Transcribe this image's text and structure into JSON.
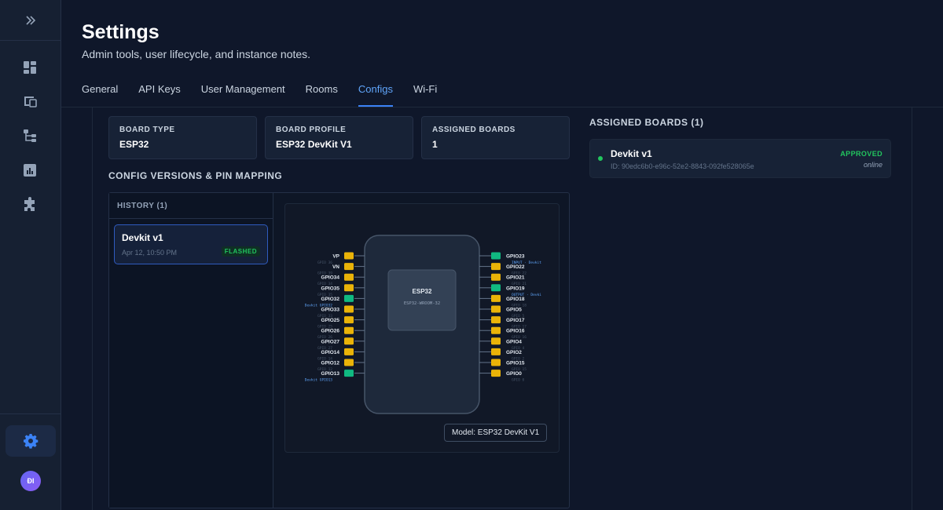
{
  "sidebar": {
    "toggle_icon": "chevrons-right-icon",
    "items": [
      {
        "icon": "dashboard-icon"
      },
      {
        "icon": "devices-icon"
      },
      {
        "icon": "hierarchy-icon"
      },
      {
        "icon": "reports-icon"
      },
      {
        "icon": "puzzle-icon"
      }
    ],
    "settings_icon": "gear-icon",
    "avatar_initials": "ĐI"
  },
  "header": {
    "title": "Settings",
    "subtitle": "Admin tools, user lifecycle, and instance notes.",
    "tabs": [
      {
        "label": "General",
        "active": false
      },
      {
        "label": "API Keys",
        "active": false
      },
      {
        "label": "User Management",
        "active": false
      },
      {
        "label": "Rooms",
        "active": false
      },
      {
        "label": "Configs",
        "active": true
      },
      {
        "label": "Wi-Fi",
        "active": false
      }
    ]
  },
  "summary_cards": [
    {
      "label": "BOARD TYPE",
      "value": "ESP32"
    },
    {
      "label": "BOARD PROFILE",
      "value": "ESP32 DevKit V1"
    },
    {
      "label": "ASSIGNED BOARDS",
      "value": "1"
    }
  ],
  "config_section": {
    "title": "CONFIG VERSIONS & PIN MAPPING",
    "history_label": "HISTORY (1)",
    "history_items": [
      {
        "name": "Devkit v1",
        "date": "Apr 12, 10:50 PM",
        "badge": "FLASHED"
      }
    ]
  },
  "board": {
    "chip_name": "ESP32",
    "chip_model": "ESP32-WROOM-32",
    "model_label": "Model: ESP32 DevKit V1",
    "left_pins": [
      {
        "name": "VP",
        "sub": "GPIO 36",
        "state": "unused"
      },
      {
        "name": "VN",
        "sub": "GPIO 39",
        "state": "unused"
      },
      {
        "name": "GPIO34",
        "sub": "GPIO 34",
        "state": "unused"
      },
      {
        "name": "GPIO35",
        "sub": "GPIO 35",
        "state": "unused"
      },
      {
        "name": "GPIO32",
        "sub": "Devkit GPIO32",
        "state": "used"
      },
      {
        "name": "GPIO33",
        "sub": "GPIO 33",
        "state": "unused"
      },
      {
        "name": "GPIO25",
        "sub": "GPIO 25",
        "state": "unused"
      },
      {
        "name": "GPIO26",
        "sub": "GPIO 26",
        "state": "unused"
      },
      {
        "name": "GPIO27",
        "sub": "GPIO 27",
        "state": "unused"
      },
      {
        "name": "GPIO14",
        "sub": "GPIO 14",
        "state": "unused"
      },
      {
        "name": "GPIO12",
        "sub": "GPIO 12",
        "state": "unused"
      },
      {
        "name": "GPIO13",
        "sub": "Devkit GPIO13",
        "state": "used"
      }
    ],
    "right_pins": [
      {
        "name": "GPIO23",
        "sub": "INPUT · Devkit",
        "state": "used"
      },
      {
        "name": "GPIO22",
        "sub": "GPIO 22",
        "state": "unused"
      },
      {
        "name": "GPIO21",
        "sub": "GPIO 21",
        "state": "unused"
      },
      {
        "name": "GPIO19",
        "sub": "OUTPUT · Devki",
        "state": "used"
      },
      {
        "name": "GPIO18",
        "sub": "GPIO 18",
        "state": "unused"
      },
      {
        "name": "GPIO5",
        "sub": "GPIO 5",
        "state": "unused"
      },
      {
        "name": "GPIO17",
        "sub": "GPIO 17",
        "state": "unused"
      },
      {
        "name": "GPIO16",
        "sub": "GPIO 16",
        "state": "unused"
      },
      {
        "name": "GPIO4",
        "sub": "GPIO 4",
        "state": "unused"
      },
      {
        "name": "GPIO2",
        "sub": "GPIO 2",
        "state": "unused"
      },
      {
        "name": "GPIO15",
        "sub": "GPIO 15",
        "state": "unused"
      },
      {
        "name": "GPIO0",
        "sub": "GPIO 0",
        "state": "unused"
      }
    ],
    "colors": {
      "used": "#10b981",
      "unused": "#eab308"
    }
  },
  "assigned_section": {
    "title": "ASSIGNED BOARDS (1)",
    "boards": [
      {
        "name": "Devkit v1",
        "id": "ID: 90edc6b0-e96c-52e2-8843-092fe528065e",
        "status": "APPROVED",
        "connection": "online"
      }
    ]
  }
}
